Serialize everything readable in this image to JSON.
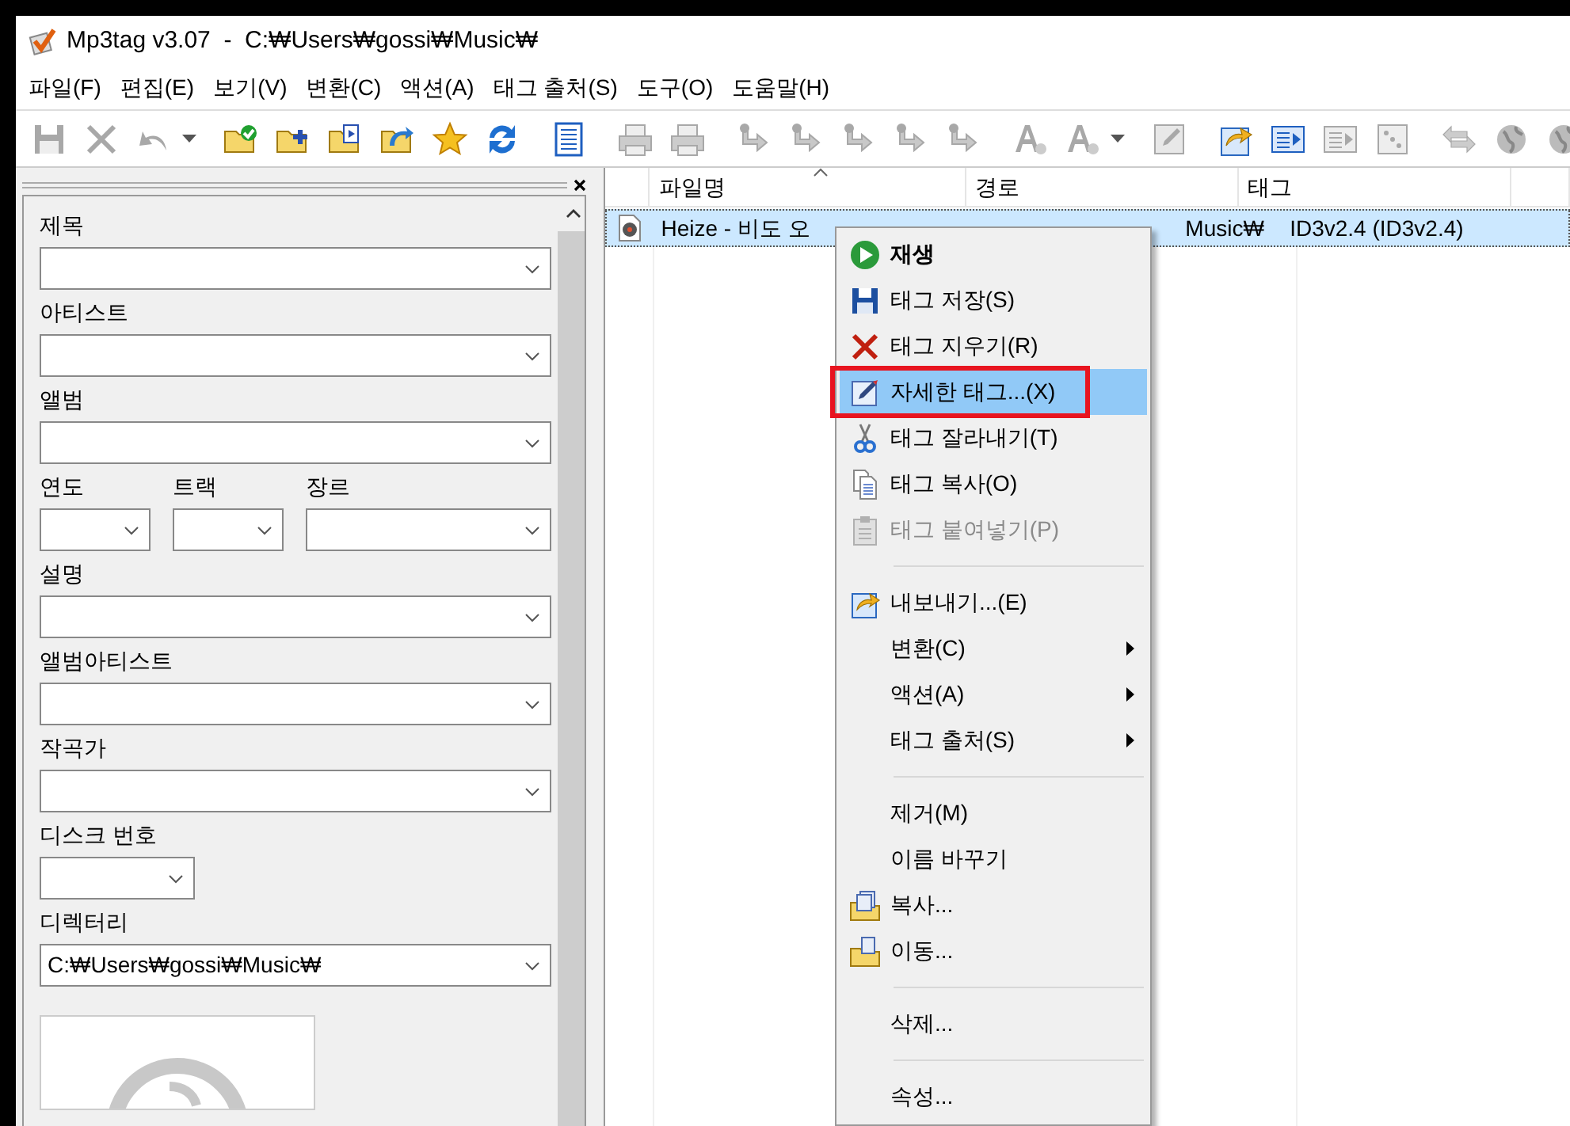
{
  "window": {
    "title": "Mp3tag v3.07  -  C:₩Users₩gossi₩Music₩"
  },
  "menu": [
    {
      "label": "파일(F)"
    },
    {
      "label": "편집(E)"
    },
    {
      "label": "보기(V)"
    },
    {
      "label": "변환(C)"
    },
    {
      "label": "액션(A)"
    },
    {
      "label": "태그 출처(S)"
    },
    {
      "label": "도구(O)"
    },
    {
      "label": "도움말(H)"
    }
  ],
  "toolbar": [
    {
      "kind": "button",
      "disabled": true
    },
    {
      "kind": "button",
      "disabled": true
    },
    {
      "kind": "button",
      "disabled": true
    },
    {
      "kind": "dropdown",
      "disabled": false
    },
    {
      "kind": "separator"
    },
    {
      "kind": "button",
      "disabled": false
    },
    {
      "kind": "button",
      "disabled": false
    },
    {
      "kind": "button",
      "disabled": false
    },
    {
      "kind": "button",
      "disabled": false
    },
    {
      "kind": "button",
      "disabled": false
    },
    {
      "kind": "button",
      "disabled": false
    },
    {
      "kind": "separator"
    },
    {
      "kind": "button",
      "disabled": false
    },
    {
      "kind": "separator"
    },
    {
      "kind": "button",
      "disabled": true
    },
    {
      "kind": "button",
      "disabled": true
    },
    {
      "kind": "separator"
    },
    {
      "kind": "button",
      "disabled": true
    },
    {
      "kind": "button",
      "disabled": true
    },
    {
      "kind": "button",
      "disabled": true
    },
    {
      "kind": "button",
      "disabled": true
    },
    {
      "kind": "button",
      "disabled": true
    },
    {
      "kind": "separator"
    },
    {
      "kind": "button",
      "disabled": true
    },
    {
      "kind": "button",
      "disabled": true
    },
    {
      "kind": "dropdown",
      "disabled": false
    },
    {
      "kind": "separator"
    },
    {
      "kind": "button",
      "disabled": true
    },
    {
      "kind": "separator"
    },
    {
      "kind": "button",
      "disabled": false
    },
    {
      "kind": "button",
      "disabled": false
    },
    {
      "kind": "button",
      "disabled": true
    },
    {
      "kind": "button",
      "disabled": true
    },
    {
      "kind": "separator"
    },
    {
      "kind": "button",
      "disabled": true
    },
    {
      "kind": "button",
      "disabled": true
    },
    {
      "kind": "button",
      "disabled": true
    }
  ],
  "tag_panel": {
    "rows": [
      {
        "kind": "full",
        "label": "제목"
      },
      {
        "kind": "full",
        "label": "아티스트"
      },
      {
        "kind": "full",
        "label": "앨범"
      },
      {
        "kind": "triple",
        "fields": [
          {
            "label": "연도"
          },
          {
            "label": "트랙"
          },
          {
            "label": "장르"
          }
        ]
      },
      {
        "kind": "full",
        "label": "설명"
      },
      {
        "kind": "full",
        "label": "앨범아티스트"
      },
      {
        "kind": "full",
        "label": "작곡가"
      },
      {
        "kind": "short",
        "label": "디스크 번호"
      },
      {
        "kind": "full",
        "label": "디렉터리",
        "value": "C:₩Users₩gossi₩Music₩"
      }
    ]
  },
  "file_list": {
    "columns": [
      {
        "label": "파일명",
        "sorted": true
      },
      {
        "label": "경로",
        "sorted": false
      },
      {
        "label": "태그",
        "sorted": false
      },
      {
        "sorted": false
      }
    ],
    "rows": [
      {
        "selected": true,
        "file_name": "Heize - 비도 오",
        "path": "Music₩",
        "tag": "ID3v2.4 (ID3v2.4)"
      }
    ]
  },
  "context_menu": [
    {
      "kind": "item",
      "label": "재생",
      "bold": true,
      "disabled": false,
      "selected": false,
      "outlined": false
    },
    {
      "kind": "item",
      "label": "태그 저장(S)",
      "bold": false,
      "disabled": false,
      "selected": false,
      "outlined": false
    },
    {
      "kind": "item",
      "label": "태그 지우기(R)",
      "bold": false,
      "disabled": false,
      "selected": false,
      "outlined": false
    },
    {
      "kind": "item",
      "label": "자세한 태그...(X)",
      "bold": false,
      "disabled": false,
      "selected": true,
      "outlined": true
    },
    {
      "kind": "item",
      "label": "태그 잘라내기(T)",
      "bold": false,
      "disabled": false,
      "selected": false,
      "outlined": false
    },
    {
      "kind": "item",
      "label": "태그 복사(O)",
      "bold": false,
      "disabled": false,
      "selected": false,
      "outlined": false
    },
    {
      "kind": "item",
      "label": "태그 붙여넣기(P)",
      "bold": false,
      "disabled": true,
      "selected": false,
      "outlined": false
    },
    {
      "kind": "separator"
    },
    {
      "kind": "item",
      "label": "내보내기...(E)",
      "bold": false,
      "disabled": false,
      "selected": false,
      "outlined": false
    },
    {
      "kind": "submenu",
      "label": "변환(C)",
      "bold": false,
      "disabled": false,
      "selected": false,
      "outlined": false
    },
    {
      "kind": "submenu",
      "label": "액션(A)",
      "bold": false,
      "disabled": false,
      "selected": false,
      "outlined": false
    },
    {
      "kind": "submenu",
      "label": "태그 출처(S)",
      "bold": false,
      "disabled": false,
      "selected": false,
      "outlined": false
    },
    {
      "kind": "separator"
    },
    {
      "kind": "item",
      "label": "제거(M)",
      "bold": false,
      "disabled": false,
      "selected": false,
      "outlined": false
    },
    {
      "kind": "item",
      "label": "이름 바꾸기",
      "bold": false,
      "disabled": false,
      "selected": false,
      "outlined": false
    },
    {
      "kind": "item",
      "label": "복사...",
      "bold": false,
      "disabled": false,
      "selected": false,
      "outlined": false
    },
    {
      "kind": "item",
      "label": "이동...",
      "bold": false,
      "disabled": false,
      "selected": false,
      "outlined": false
    },
    {
      "kind": "separator"
    },
    {
      "kind": "item",
      "label": "삭제...",
      "bold": false,
      "disabled": false,
      "selected": false,
      "outlined": false
    },
    {
      "kind": "separator"
    },
    {
      "kind": "item",
      "label": "속성...",
      "bold": false,
      "disabled": false,
      "selected": false,
      "outlined": false
    }
  ]
}
